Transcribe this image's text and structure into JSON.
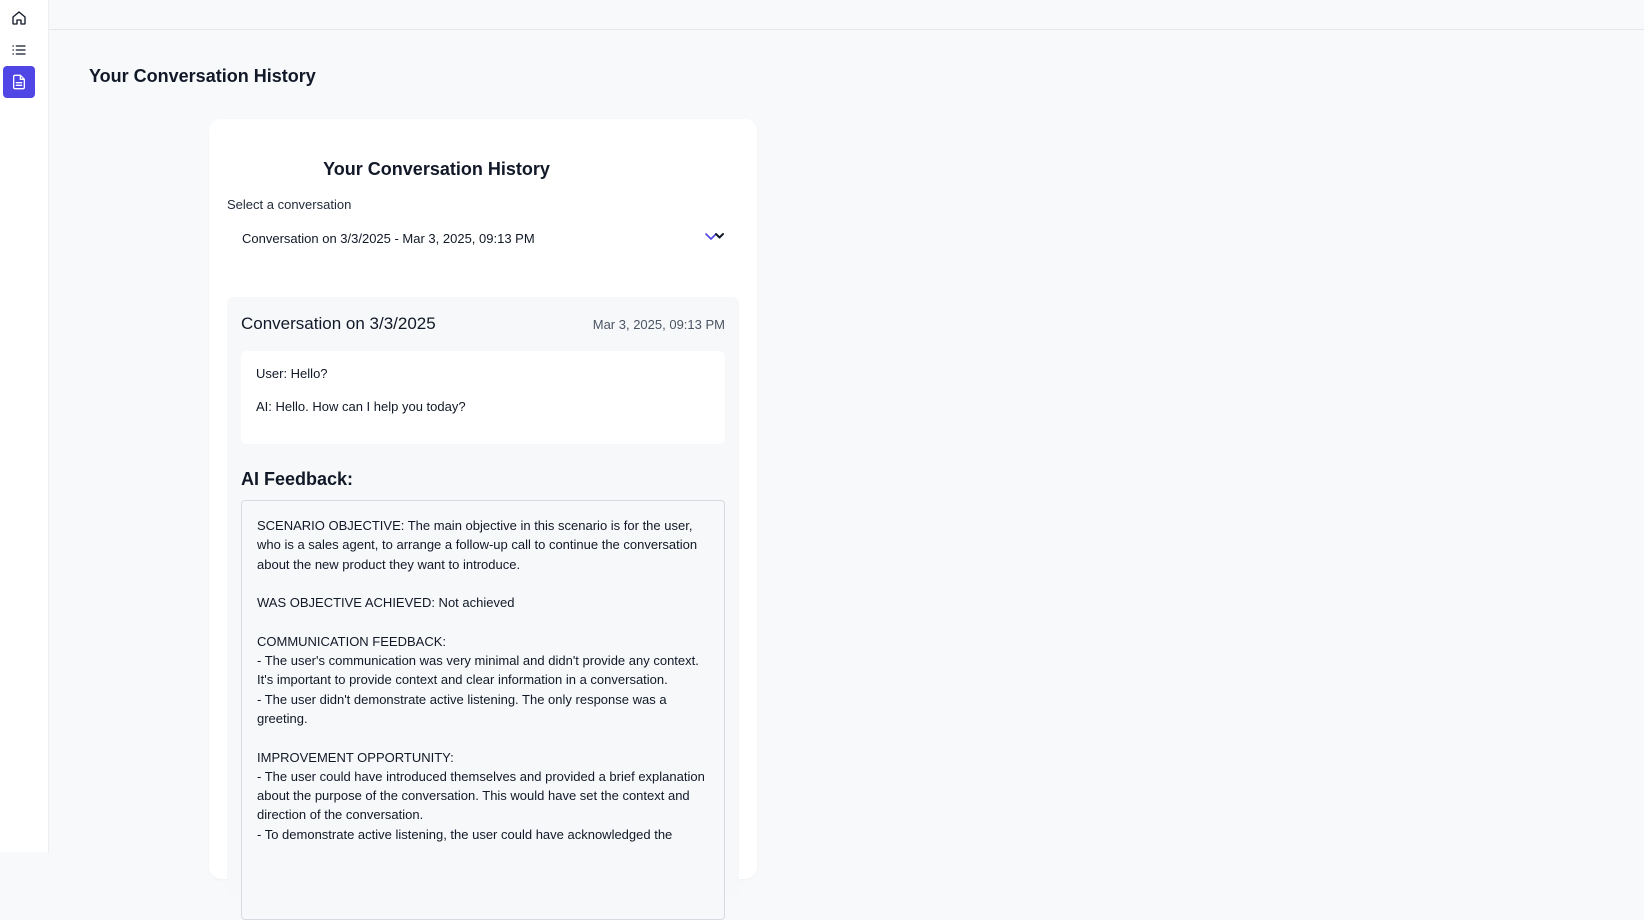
{
  "app": {
    "page_title": "Your Conversation History",
    "accent_color": "#4f46e5"
  },
  "sidebar": {
    "items": [
      {
        "icon": "home-icon",
        "active": false
      },
      {
        "icon": "list-icon",
        "active": false
      },
      {
        "icon": "document-icon",
        "active": true
      }
    ]
  },
  "card": {
    "title": "Your Conversation History",
    "select_label": "Select a conversation",
    "selected_value": "Conversation on 3/3/2025 - Mar 3, 2025, 09:13 PM"
  },
  "conversation": {
    "title": "Conversation on 3/3/2025",
    "date": "Mar 3, 2025, 09:13 PM",
    "messages": [
      "User: Hello?",
      "AI: Hello. How can I help you today?"
    ],
    "feedback_heading": "AI Feedback:",
    "feedback_text": "SCENARIO OBJECTIVE: The main objective in this scenario is for the user, who is a sales agent, to arrange a follow-up call to continue the conversation about the new product they want to introduce.\n\nWAS OBJECTIVE ACHIEVED: Not achieved\n\nCOMMUNICATION FEEDBACK:\n- The user's communication was very minimal and didn't provide any context. It's important to provide context and clear information in a conversation.\n- The user didn't demonstrate active listening. The only response was a greeting.\n\nIMPROVEMENT OPPORTUNITY:\n- The user could have introduced themselves and provided a brief explanation about the purpose of the conversation. This would have set the context and direction of the conversation.\n- To demonstrate active listening, the user could have acknowledged the"
  }
}
